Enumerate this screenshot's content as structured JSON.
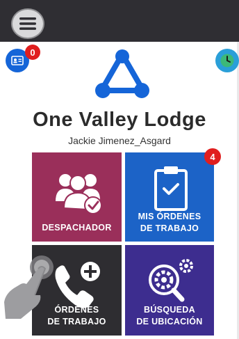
{
  "header": {
    "menu_icon": "hamburger-menu-icon"
  },
  "status": {
    "left_icon": "id-card-icon",
    "left_badge": "0",
    "right_icon": "clock-icon"
  },
  "brand": {
    "logo_icon": "triangle-logo-icon",
    "title": "One Valley Lodge",
    "user": "Jackie Jimenez_Asgard"
  },
  "tiles": [
    {
      "label_line1": "DESPACHADOR",
      "label_line2": "",
      "icon": "users-check-icon",
      "color": "#9a2f5a",
      "badge": ""
    },
    {
      "label_line1": "MIS ÓRDENES",
      "label_line2": "DE TRABAJO",
      "icon": "clipboard-check-icon",
      "color": "#1c63c7",
      "badge": "4"
    },
    {
      "label_line1": "ÓRDENES",
      "label_line2": "DE TRABAJO",
      "icon": "phone-plus-icon",
      "color": "#2e2d31",
      "badge": ""
    },
    {
      "label_line1": "BÚSQUEDA",
      "label_line2": "DE UBICACIÓN",
      "icon": "gear-search-icon",
      "color": "#3d2d8f",
      "badge": ""
    }
  ],
  "overlay": {
    "icon": "tap-hand-icon"
  }
}
